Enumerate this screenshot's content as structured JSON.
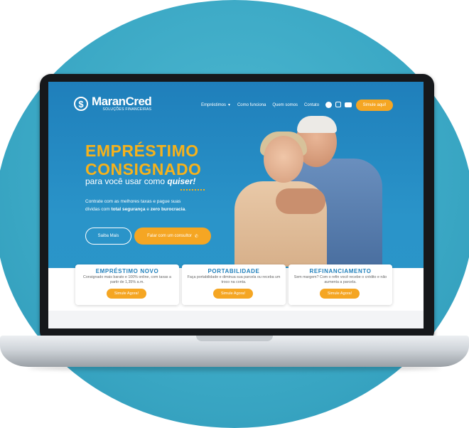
{
  "brand": {
    "name": "MaranCred",
    "tagline": "SOLUÇÕES FINANCEIRAS"
  },
  "nav": {
    "items": [
      "Empréstimos",
      "Como funciona",
      "Quem somos",
      "Contato"
    ],
    "cta": "Simule aqui!"
  },
  "hero": {
    "title_line1": "EMPRÉSTIMO",
    "title_line2": "CONSIGNADO",
    "subtitle_start": "para você usar como ",
    "subtitle_emphasis": "quiser!",
    "description_line1": "Contrate com as melhores taxas  e pague suas",
    "description_line2_start": "dívidas com ",
    "description_bold1": "total segurança",
    "description_mid": " e ",
    "description_bold2": "zero burocracia",
    "description_end": ".",
    "btn_more": "Saiba Mais",
    "btn_consultant": "Falar com um consultor"
  },
  "cards": [
    {
      "title": "EMPRÉSTIMO NOVO",
      "text": "Consignado mais barato e 100% online, com taxas a partir de 1,35% a.m.",
      "button": "Simule Agora!"
    },
    {
      "title": "PORTABILIDADE",
      "text": "Faça portabilidade e diminua sua parcela ou receba um troco na conta.",
      "button": "Simule Agora!"
    },
    {
      "title": "REFINANCIAMENTO",
      "text": "Sem margem? Com o refin você recebe o crédito e não aumenta a parcela.",
      "button": "Simule Agora!"
    }
  ],
  "icons": [
    "dollar-coin-icon",
    "chevron-down-icon",
    "facebook-icon",
    "instagram-icon",
    "youtube-icon",
    "whatsapp-icon"
  ],
  "colors": {
    "accent": "#f5a623",
    "primary": "#1f7fbb",
    "background_circle": "#3aa7c4"
  }
}
